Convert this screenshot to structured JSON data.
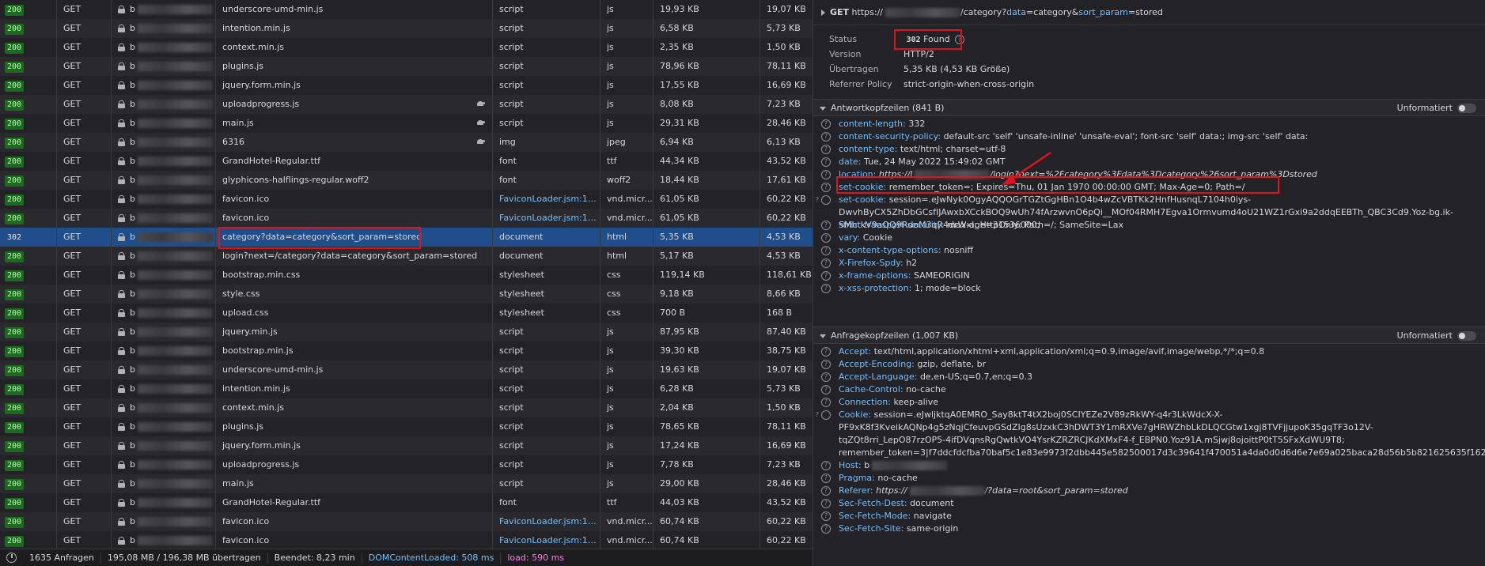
{
  "requests": [
    {
      "status": "200",
      "method": "GET",
      "domain": "b",
      "file": "underscore-umd-min.js",
      "initiator": "script",
      "type": "js",
      "transferred": "19,93 KB",
      "size": "19,07 KB"
    },
    {
      "status": "200",
      "method": "GET",
      "domain": "b",
      "file": "intention.min.js",
      "initiator": "script",
      "type": "js",
      "transferred": "6,58 KB",
      "size": "5,73 KB"
    },
    {
      "status": "200",
      "method": "GET",
      "domain": "b",
      "file": "context.min.js",
      "initiator": "script",
      "type": "js",
      "transferred": "2,35 KB",
      "size": "1,50 KB"
    },
    {
      "status": "200",
      "method": "GET",
      "domain": "b",
      "file": "plugins.js",
      "initiator": "script",
      "type": "js",
      "transferred": "78,96 KB",
      "size": "78,11 KB"
    },
    {
      "status": "200",
      "method": "GET",
      "domain": "b",
      "file": "jquery.form.min.js",
      "initiator": "script",
      "type": "js",
      "transferred": "17,55 KB",
      "size": "16,69 KB"
    },
    {
      "status": "200",
      "method": "GET",
      "domain": "b",
      "file": "uploadprogress.js",
      "initiator": "script",
      "type": "js",
      "transferred": "8,08 KB",
      "size": "7,23 KB",
      "slow": true
    },
    {
      "status": "200",
      "method": "GET",
      "domain": "b",
      "file": "main.js",
      "initiator": "script",
      "type": "js",
      "transferred": "29,31 KB",
      "size": "28,46 KB",
      "slow": true
    },
    {
      "status": "200",
      "method": "GET",
      "domain": "b",
      "file": "6316",
      "initiator": "img",
      "type": "jpeg",
      "transferred": "6,94 KB",
      "size": "6,13 KB",
      "slow": true
    },
    {
      "status": "200",
      "method": "GET",
      "domain": "b",
      "file": "GrandHotel-Regular.ttf",
      "initiator": "font",
      "type": "ttf",
      "transferred": "44,34 KB",
      "size": "43,52 KB"
    },
    {
      "status": "200",
      "method": "GET",
      "domain": "b",
      "file": "glyphicons-halflings-regular.woff2",
      "initiator": "font",
      "type": "woff2",
      "transferred": "18,44 KB",
      "size": "17,61 KB"
    },
    {
      "status": "200",
      "method": "GET",
      "domain": "b",
      "file": "favicon.ico",
      "initiator": "FaviconLoader.jsm:191 ...",
      "initiator_link": true,
      "type": "vnd.micr...",
      "transferred": "61,05 KB",
      "size": "60,22 KB"
    },
    {
      "status": "200",
      "method": "GET",
      "domain": "b",
      "file": "favicon.ico",
      "initiator": "FaviconLoader.jsm:191 ...",
      "initiator_link": true,
      "type": "vnd.micr...",
      "transferred": "61,05 KB",
      "size": "60,22 KB"
    },
    {
      "status": "302",
      "method": "GET",
      "domain": "b",
      "file": "category?data=category&sort_param=stored",
      "initiator": "document",
      "type": "html",
      "transferred": "5,35 KB",
      "size": "4,53 KB",
      "selected": true
    },
    {
      "status": "200",
      "method": "GET",
      "domain": "b",
      "file": "login?next=/category?data=category&sort_param=stored",
      "initiator": "document",
      "type": "html",
      "transferred": "5,17 KB",
      "size": "4,53 KB"
    },
    {
      "status": "200",
      "method": "GET",
      "domain": "b",
      "file": "bootstrap.min.css",
      "initiator": "stylesheet",
      "type": "css",
      "transferred": "119,14 KB",
      "size": "118,61 KB"
    },
    {
      "status": "200",
      "method": "GET",
      "domain": "b",
      "file": "style.css",
      "initiator": "stylesheet",
      "type": "css",
      "transferred": "9,18 KB",
      "size": "8,66 KB"
    },
    {
      "status": "200",
      "method": "GET",
      "domain": "b",
      "file": "upload.css",
      "initiator": "stylesheet",
      "type": "css",
      "transferred": "700 B",
      "size": "168 B"
    },
    {
      "status": "200",
      "method": "GET",
      "domain": "b",
      "file": "jquery.min.js",
      "initiator": "script",
      "type": "js",
      "transferred": "87,95 KB",
      "size": "87,40 KB"
    },
    {
      "status": "200",
      "method": "GET",
      "domain": "b",
      "file": "bootstrap.min.js",
      "initiator": "script",
      "type": "js",
      "transferred": "39,30 KB",
      "size": "38,75 KB"
    },
    {
      "status": "200",
      "method": "GET",
      "domain": "b",
      "file": "underscore-umd-min.js",
      "initiator": "script",
      "type": "js",
      "transferred": "19,63 KB",
      "size": "19,07 KB"
    },
    {
      "status": "200",
      "method": "GET",
      "domain": "b",
      "file": "intention.min.js",
      "initiator": "script",
      "type": "js",
      "transferred": "6,28 KB",
      "size": "5,73 KB"
    },
    {
      "status": "200",
      "method": "GET",
      "domain": "b",
      "file": "context.min.js",
      "initiator": "script",
      "type": "js",
      "transferred": "2,04 KB",
      "size": "1,50 KB"
    },
    {
      "status": "200",
      "method": "GET",
      "domain": "b",
      "file": "plugins.js",
      "initiator": "script",
      "type": "js",
      "transferred": "78,65 KB",
      "size": "78,11 KB"
    },
    {
      "status": "200",
      "method": "GET",
      "domain": "b",
      "file": "jquery.form.min.js",
      "initiator": "script",
      "type": "js",
      "transferred": "17,24 KB",
      "size": "16,69 KB"
    },
    {
      "status": "200",
      "method": "GET",
      "domain": "b",
      "file": "uploadprogress.js",
      "initiator": "script",
      "type": "js",
      "transferred": "7,78 KB",
      "size": "7,23 KB"
    },
    {
      "status": "200",
      "method": "GET",
      "domain": "b",
      "file": "main.js",
      "initiator": "script",
      "type": "js",
      "transferred": "29,00 KB",
      "size": "28,46 KB"
    },
    {
      "status": "200",
      "method": "GET",
      "domain": "b",
      "file": "GrandHotel-Regular.ttf",
      "initiator": "font",
      "type": "ttf",
      "transferred": "44,03 KB",
      "size": "43,52 KB"
    },
    {
      "status": "200",
      "method": "GET",
      "domain": "b",
      "file": "favicon.ico",
      "initiator": "FaviconLoader.jsm:191 ...",
      "initiator_link": true,
      "type": "vnd.micr...",
      "transferred": "60,74 KB",
      "size": "60,22 KB"
    },
    {
      "status": "200",
      "method": "GET",
      "domain": "b",
      "file": "favicon.ico",
      "initiator": "FaviconLoader.jsm:191 ...",
      "initiator_link": true,
      "type": "vnd.micr...",
      "transferred": "60,74 KB",
      "size": "60,22 KB"
    }
  ],
  "statusbar": {
    "requests": "1635 Anfragen",
    "transferred": "195,08 MB / 196,38 MB übertragen",
    "finished": "Beendet: 8,23 min",
    "domcontent": "DOMContentLoaded: 508 ms",
    "load": "load: 590 ms"
  },
  "details": {
    "method": "GET",
    "url_prefix": "https://",
    "url_path": "/category?",
    "url_param1": "data",
    "url_eq1": "=category&",
    "url_param2": "sort_param",
    "url_eq2": "=stored",
    "status_label": "Status",
    "status_code": "302",
    "status_text": "Found",
    "version_label": "Version",
    "version": "HTTP/2",
    "transferred_label": "Übertragen",
    "transferred": "5,35 KB (4,53 KB Größe)",
    "referrer_label": "Referrer Policy",
    "referrer": "strict-origin-when-cross-origin"
  },
  "response_section": {
    "title": "Antwortkopfzeilen (841 B)",
    "raw_label": "Unformatiert"
  },
  "response_headers": [
    {
      "name": "content-length:",
      "value": "332"
    },
    {
      "name": "content-security-policy:",
      "value": "default-src 'self' 'unsafe-inline' 'unsafe-eval'; font-src 'self' data:; img-src 'self' data:"
    },
    {
      "name": "content-type:",
      "value": "text/html; charset=utf-8"
    },
    {
      "name": "date:",
      "value": "Tue, 24 May 2022 15:49:02 GMT"
    },
    {
      "name": "location:",
      "value": "https://l",
      "value2": "/login?next=%2Fcategory%3Fdata%3Dcategory%26sort_param%3Dstored"
    },
    {
      "name": "set-cookie:",
      "value": "remember_token=; Expires=Thu, 01 Jan 1970 00:00:00 GMT; Max-Age=0; Path=/"
    },
    {
      "name": "set-cookie:",
      "value": "session=.eJwNyk0OgyAQQOGrTGZtGgHBn1O4b4wZcVBTKk2HnfHusnqL7104h0iys-DwvhByCX5ZhDbGCsfIJAwxbXCckBOQ9wUh74fArzwvnO6pQi__MOf04RMH7Egva1Ormvumd4oU21WZ1rGxi9a2ddqEEBTh_QBC3Cd9.Yoz-bg.ik-SMhtkV9aOQ9RdoM3qR4drWxI; HttpOnly; Path=/; SameSite=Lax"
    },
    {
      "name": "strict-transport-security:",
      "value": "max-age=31536000;"
    },
    {
      "name": "vary:",
      "value": "Cookie"
    },
    {
      "name": "x-content-type-options:",
      "value": "nosniff"
    },
    {
      "name": "X-Firefox-Spdy:",
      "value": "h2"
    },
    {
      "name": "x-frame-options:",
      "value": "SAMEORIGIN"
    },
    {
      "name": "x-xss-protection:",
      "value": "1; mode=block"
    }
  ],
  "request_section": {
    "title": "Anfragekopfzeilen (1,007 KB)",
    "raw_label": "Unformatiert"
  },
  "request_headers": [
    {
      "name": "Accept:",
      "value": "text/html,application/xhtml+xml,application/xml;q=0.9,image/avif,image/webp,*/*;q=0.8"
    },
    {
      "name": "Accept-Encoding:",
      "value": "gzip, deflate, br"
    },
    {
      "name": "Accept-Language:",
      "value": "de,en-US;q=0.7,en;q=0.3"
    },
    {
      "name": "Cache-Control:",
      "value": "no-cache"
    },
    {
      "name": "Connection:",
      "value": "keep-alive"
    },
    {
      "name": "Cookie:",
      "value": "session=.eJwljktqA0EMRO_Say8ktT4tX2boj0SCIYEZe2V89zRkWY-q4r3LkWdcX-X-PF9xK8f3KveikAQNp4g5zNqjCfeuvpGSdZIg8sUzxkC3hDWT3Y1mRXVe7gHRWZhbLkDLQCGtw1xgj8TVFjjupoK35gqTF3o12V-tqZQt8rri_LepO87rzOP5-4ifDVqnsRgQwtkVO4YsrKZRZRCJKdXMxF4-f_EBPN0.Yoz91A.mSjwj8ojoittP0tT5SFxXdWU9T8; remember_token=3|f7ddcfdcfba70baf5c1e83e9973f2dbb445e582500017d3c39641f470051a4da0d0d6d6e7e69a025baca28d56b5b821625635f162b55ffd0af2f8bdd6f994d88"
    },
    {
      "name": "Host:",
      "value": "b"
    },
    {
      "name": "Pragma:",
      "value": "no-cache"
    },
    {
      "name": "Referer:",
      "value": "https://",
      "value2": "/?data=root&sort_param=stored"
    },
    {
      "name": "Sec-Fetch-Dest:",
      "value": "document"
    },
    {
      "name": "Sec-Fetch-Mode:",
      "value": "navigate"
    },
    {
      "name": "Sec-Fetch-Site:",
      "value": "same-origin"
    }
  ],
  "colors": {
    "highlight": "#e0121d",
    "selected_row": "#204e8a",
    "status_ok_bg": "#1b6b1e",
    "link": "#75bfff",
    "domcontent": "#75bfff",
    "load": "#ff7de9"
  }
}
